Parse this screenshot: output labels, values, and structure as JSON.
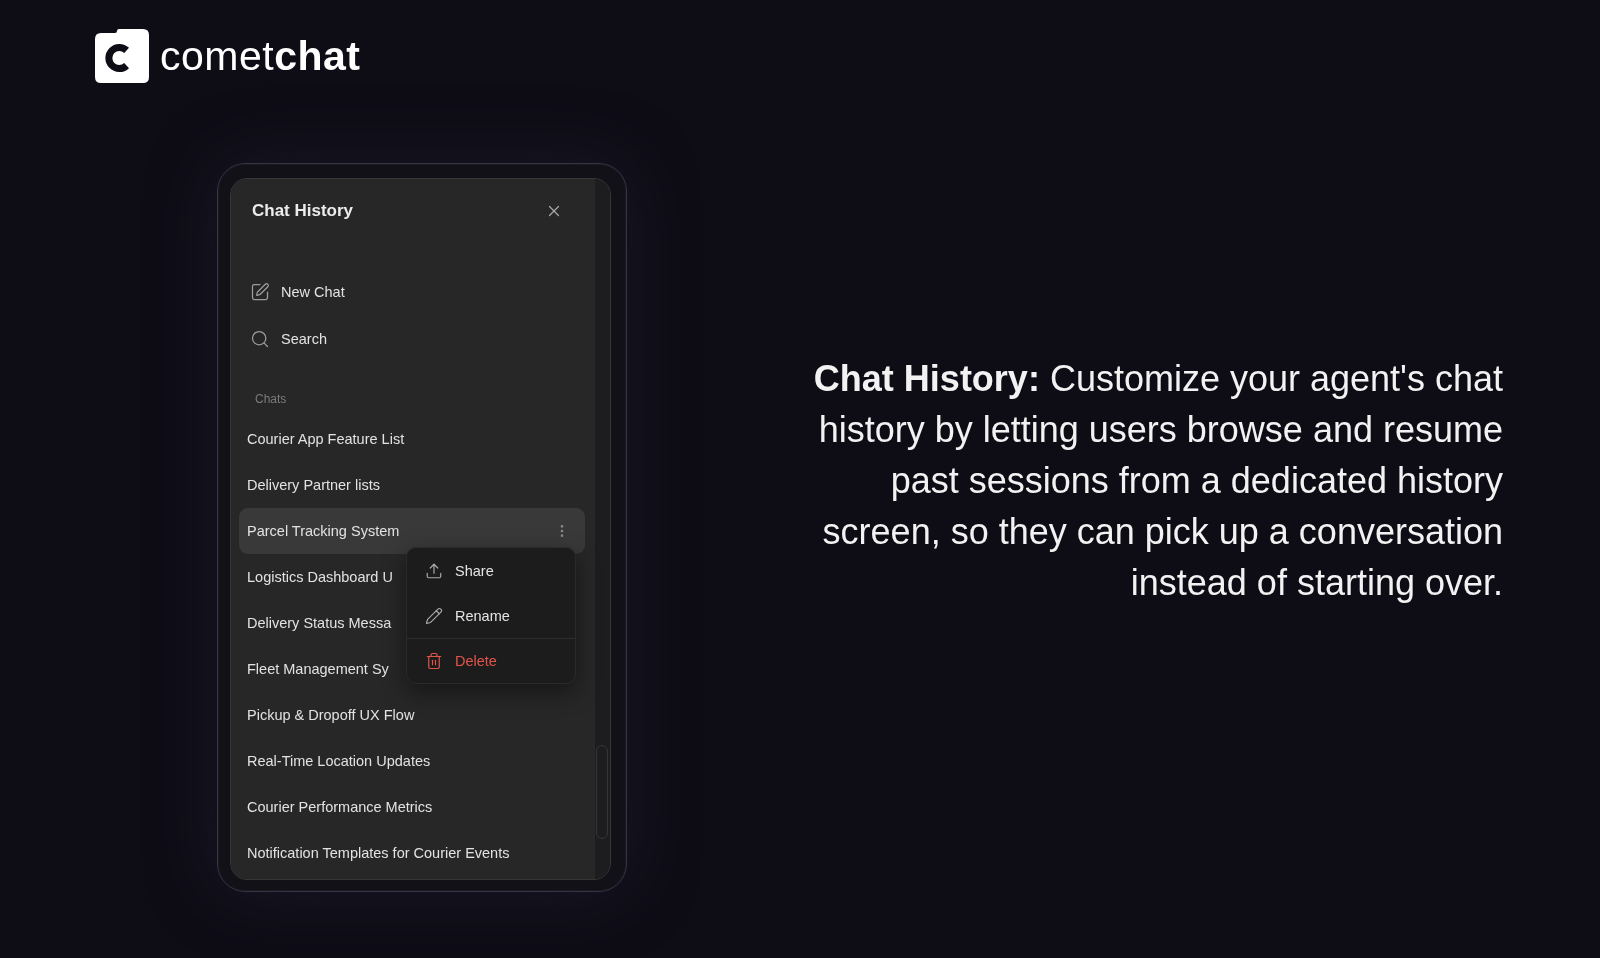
{
  "logo": {
    "wordmark": "comet**chat**"
  },
  "chat_history_panel": {
    "title": "Chat History",
    "actions": [
      {
        "kind": "new_chat",
        "label": "New Chat"
      },
      {
        "kind": "search",
        "label": "Search"
      }
    ],
    "section_label": "Chats",
    "chats": [
      {
        "title": "Courier App Feature List",
        "selected": false
      },
      {
        "title": "Delivery Partner lists",
        "selected": false
      },
      {
        "title": "Parcel Tracking System",
        "selected": true
      },
      {
        "title": "Logistics Dashboard U",
        "selected": false
      },
      {
        "title": "Delivery Status Messa",
        "selected": false
      },
      {
        "title": "Fleet Management Sy",
        "selected": false
      },
      {
        "title": "Pickup & Dropoff UX Flow",
        "selected": false
      },
      {
        "title": "Real-Time Location Updates",
        "selected": false
      },
      {
        "title": "Courier Performance Metrics",
        "selected": false
      },
      {
        "title": "Notification Templates for Courier Events",
        "selected": false
      }
    ],
    "context_menu": {
      "items": [
        {
          "kind": "share",
          "label": "Share",
          "danger": false
        },
        {
          "kind": "rename",
          "label": "Rename",
          "danger": false
        },
        {
          "kind": "delete",
          "label": "Delete",
          "danger": true
        }
      ]
    }
  },
  "description": "**Chat History:** Customize your agent's chat history by letting users browse and resume past sessions from a dedicated history screen, so they can pick up a conversation instead of starting over."
}
